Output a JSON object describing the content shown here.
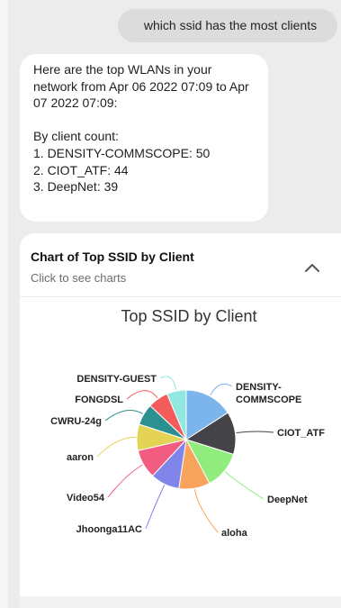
{
  "conversation": {
    "user_message": "which ssid has the most clients",
    "bot_response": {
      "intro": "Here are the top WLANs in your network from Apr 06 2022 07:09 to Apr 07 2022 07:09:",
      "list_heading": "By client count:",
      "items": [
        "1. DENSITY-COMMSCOPE: 50",
        "2. CIOT_ATF: 44",
        "3. DeepNet: 39"
      ]
    }
  },
  "chart_card": {
    "title": "Chart of Top SSID by Client",
    "subtitle": "Click to see charts",
    "collapse_icon": "chevron-up-icon"
  },
  "chart_data": {
    "type": "pie",
    "title": "Top SSID by Client",
    "categories": [
      "DENSITY-COMMSCOPE",
      "CIOT_ATF",
      "DeepNet",
      "aloha",
      "Jhoonga11AC",
      "Video54",
      "aaron",
      "CWRU-24g",
      "FONGDSL",
      "DENSITY-GUEST"
    ],
    "label_lines": {
      "DENSITY-COMMSCOPE": [
        "DENSITY-",
        "COMMSCOPE"
      ]
    },
    "values": [
      50,
      44,
      39,
      32,
      30,
      30,
      27,
      22,
      21,
      20
    ],
    "colors": [
      "#7cb5ec",
      "#434348",
      "#90ed7d",
      "#f7a35c",
      "#8085e9",
      "#f15c80",
      "#e4d354",
      "#2b908f",
      "#f45b5b",
      "#91e8e1"
    ]
  }
}
